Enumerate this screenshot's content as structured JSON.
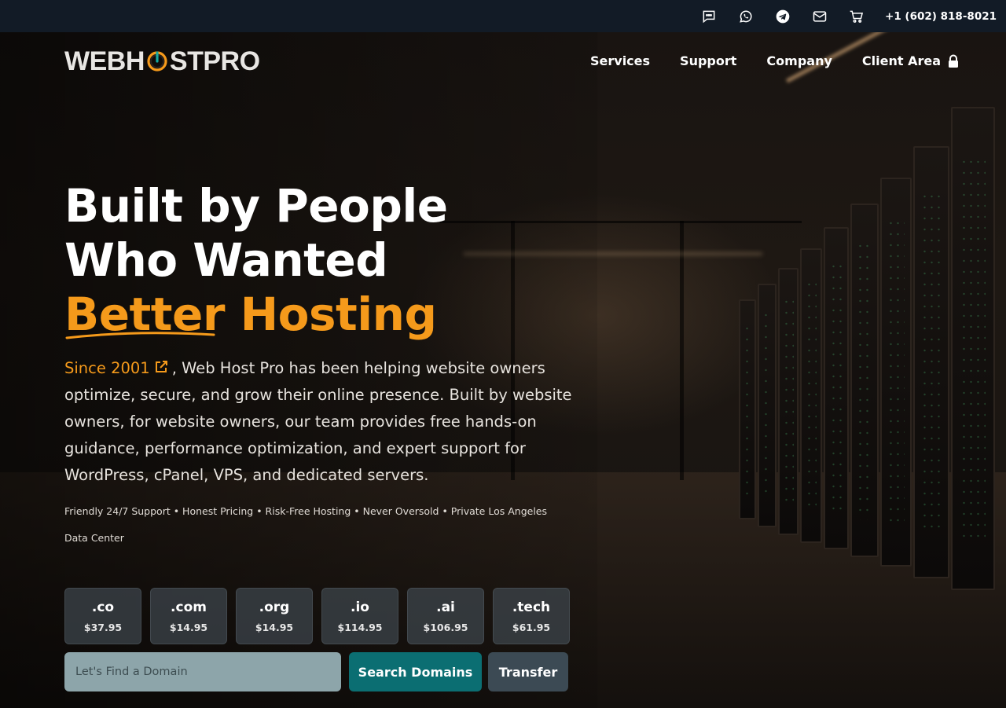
{
  "topbar": {
    "icons": [
      "chat-icon",
      "whatsapp-icon",
      "telegram-icon",
      "mail-icon",
      "cart-icon"
    ],
    "phone": "+1 (602) 818-8021"
  },
  "header": {
    "logo_left": "WEBH",
    "logo_right": "STPRO",
    "nav": [
      "Services",
      "Support",
      "Company",
      "Client Area"
    ]
  },
  "hero": {
    "title_line1": "Built by People",
    "title_line2": "Who Wanted",
    "title_accent_1": "Better",
    "title_accent_2": " Hosting",
    "since": "Since 2001",
    "description": ", Web Host Pro has been helping website owners optimize, secure, and grow their online presence. Built by website owners, for website owners, our team provides free hands-on guidance, performance optimization, and expert support for WordPress, cPanel, VPS, and dedicated servers.",
    "features": "Friendly 24/7 Support • Honest Pricing • Risk-Free Hosting • Never Oversold • Private Los Angeles Data Center"
  },
  "tlds": [
    {
      "ext": ".co",
      "price": "$37.95"
    },
    {
      "ext": ".com",
      "price": "$14.95"
    },
    {
      "ext": ".org",
      "price": "$14.95"
    },
    {
      "ext": ".io",
      "price": "$114.95"
    },
    {
      "ext": ".ai",
      "price": "$106.95"
    },
    {
      "ext": ".tech",
      "price": "$61.95"
    }
  ],
  "domain_search": {
    "placeholder": "Let's Find a Domain",
    "search_label": "Search Domains",
    "transfer_label": "Transfer"
  },
  "colors": {
    "accent": "#f59a1b",
    "topbar": "#121b26",
    "search_button": "#0b6e72",
    "transfer_button": "#3c4a54"
  }
}
